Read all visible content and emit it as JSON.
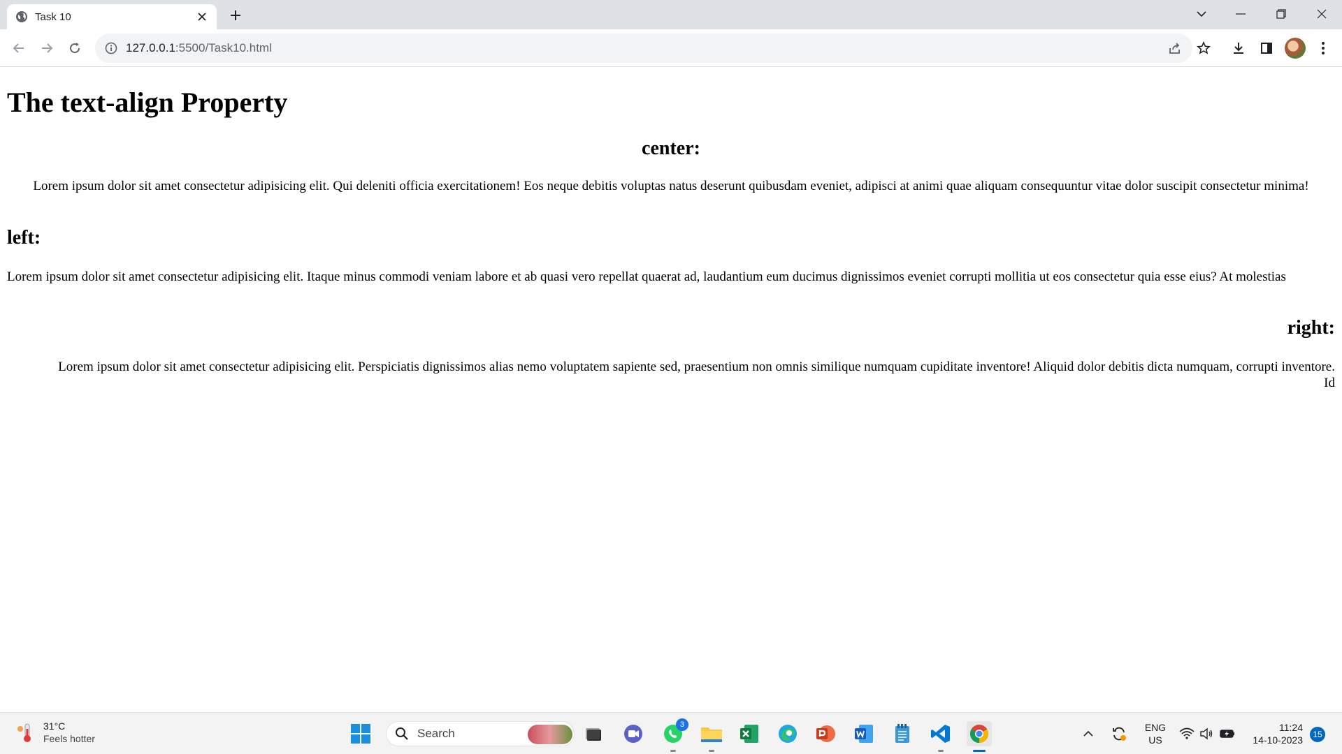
{
  "browser": {
    "tab_title": "Task 10",
    "url_host": "127.0.0.1",
    "url_path": ":5500/Task10.html"
  },
  "page": {
    "title": "The text-align Property",
    "sections": [
      {
        "heading": "center:",
        "paragraph": "Lorem ipsum dolor sit amet consectetur adipisicing elit. Qui deleniti officia exercitationem! Eos neque debitis voluptas natus deserunt quibusdam eveniet, adipisci at animi quae aliquam consequuntur vitae dolor suscipit consectetur minima!"
      },
      {
        "heading": "left:",
        "paragraph": "Lorem ipsum dolor sit amet consectetur adipisicing elit. Itaque minus commodi veniam labore et ab quasi vero repellat quaerat ad, laudantium eum ducimus dignissimos eveniet corrupti mollitia ut eos consectetur quia esse eius? At molestias"
      },
      {
        "heading": "right:",
        "paragraph": "Lorem ipsum dolor sit amet consectetur adipisicing elit. Perspiciatis dignissimos alias nemo voluptatem sapiente sed, praesentium non omnis similique numquam cupiditate inventore! Aliquid dolor debitis dicta numquam, corrupti inventore. Id"
      }
    ]
  },
  "taskbar": {
    "weather_temp": "31°C",
    "weather_desc": "Feels hotter",
    "search_label": "Search",
    "whatsapp_badge": "3",
    "lang_line1": "ENG",
    "lang_line2": "US",
    "time": "11:24",
    "date": "14-10-2023",
    "notification_count": "15"
  },
  "colors": {
    "tabstrip_bg": "#dee1e6",
    "taskbar_bg": "#f3f3f3",
    "accent": "#0067c0"
  }
}
